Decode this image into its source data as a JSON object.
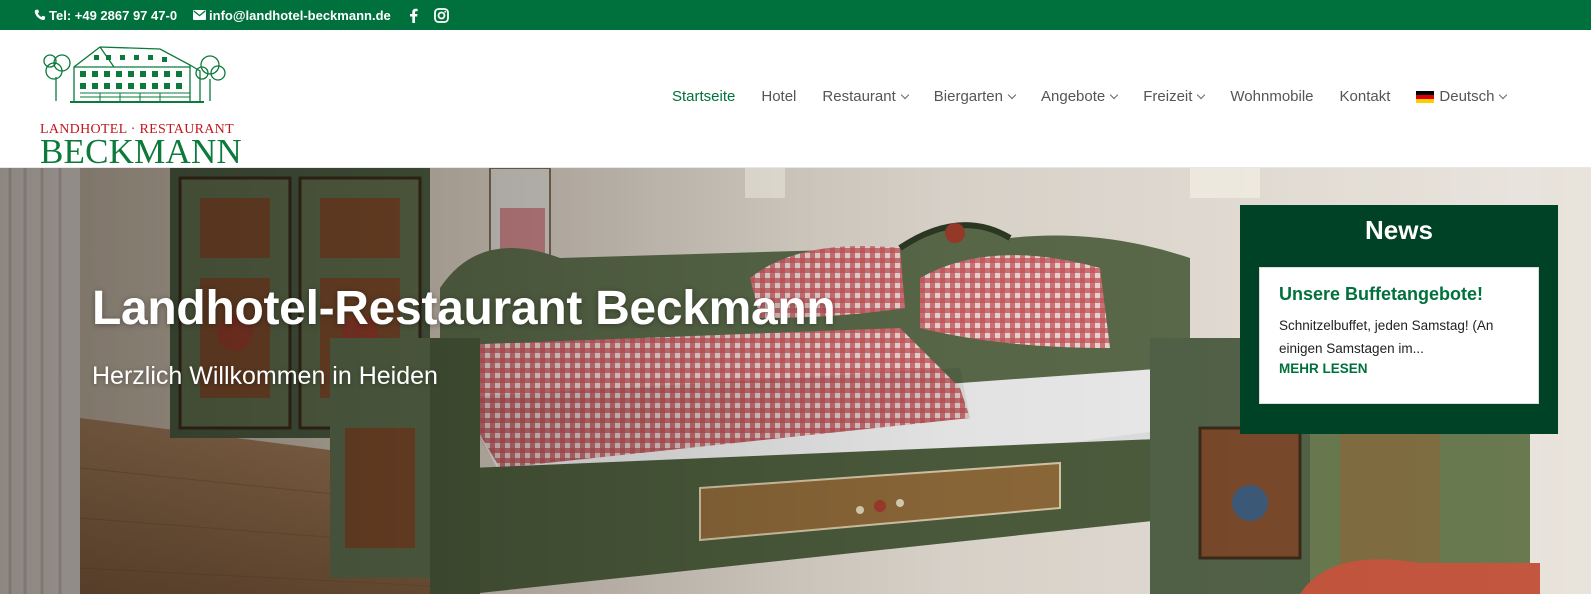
{
  "topbar": {
    "phone": "Tel: +49 2867 97 47-0",
    "email": "info@landhotel-beckmann.de",
    "social": [
      "facebook-icon",
      "instagram-icon"
    ]
  },
  "logo": {
    "subtitle": "LANDHOTEL · RESTAURANT",
    "name": "BECKMANN"
  },
  "nav": {
    "items": [
      {
        "label": "Startseite",
        "active": true
      },
      {
        "label": "Hotel"
      },
      {
        "label": "Restaurant",
        "dropdown": true
      },
      {
        "label": "Biergarten",
        "dropdown": true
      },
      {
        "label": "Angebote",
        "dropdown": true
      },
      {
        "label": "Freizeit",
        "dropdown": true
      },
      {
        "label": "Wohnmobile"
      },
      {
        "label": "Kontakt"
      },
      {
        "label": "Deutsch",
        "dropdown": true,
        "flag": "de-flag-icon"
      }
    ]
  },
  "hero": {
    "title": "Landhotel-Restaurant Beckmann",
    "subtitle": "Herzlich Willkommen in Heiden"
  },
  "news": {
    "title": "News",
    "post_title": "Unsere Buffetangebote!",
    "excerpt": "Schnitzelbuffet, jeden Samstag! (An einigen Samstagen im...",
    "more_label": "MEHR LESEN"
  },
  "colors": {
    "brand_green": "#00713c",
    "news_bg": "#004225",
    "logo_red": "#c3161c"
  }
}
